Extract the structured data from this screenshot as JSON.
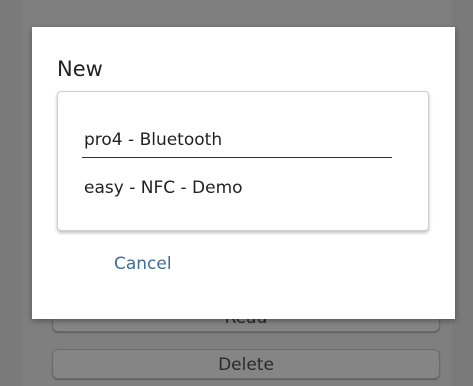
{
  "background": {
    "read_button_label": "Read",
    "delete_button_label": "Delete"
  },
  "dialog": {
    "title": "New",
    "options": [
      "pro4 - Bluetooth",
      "easy - NFC - Demo"
    ],
    "cancel_label": "Cancel",
    "cancel_color": "#3f6d94"
  }
}
